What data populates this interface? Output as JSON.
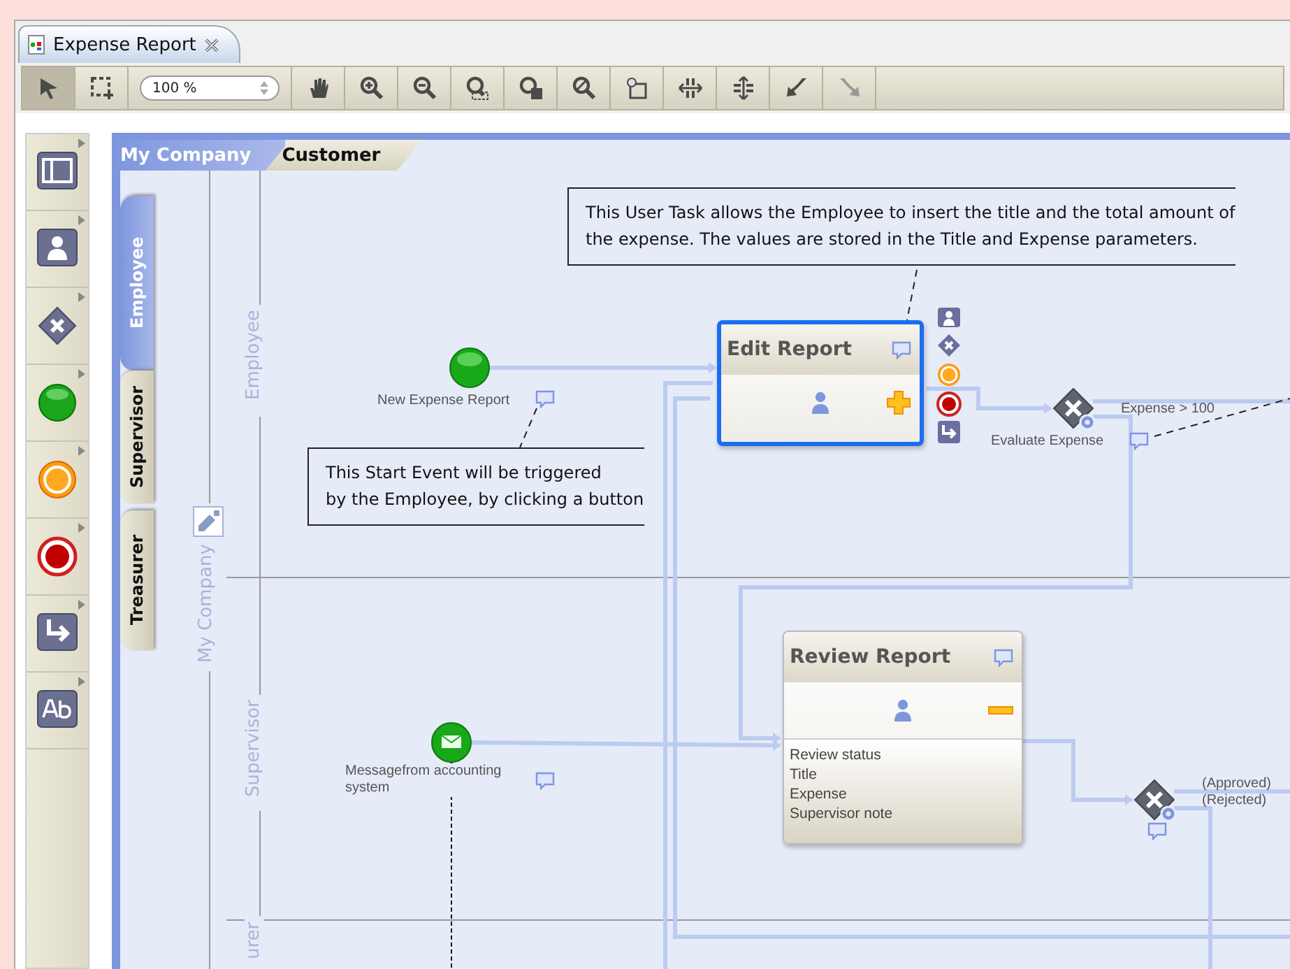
{
  "window": {
    "tab_title": "Expense Report"
  },
  "toolbar": {
    "zoom": "100 %",
    "tools_left": [
      {
        "kind": "pointer",
        "selected": true,
        "disabled": false
      },
      {
        "kind": "marquee",
        "selected": false,
        "disabled": false
      }
    ],
    "tools_right": [
      {
        "kind": "hand",
        "selected": false,
        "disabled": false
      },
      {
        "kind": "zoom_in",
        "selected": false,
        "disabled": false
      },
      {
        "kind": "zoom_out",
        "selected": false,
        "disabled": false
      },
      {
        "kind": "zoom_fit",
        "selected": false,
        "disabled": false
      },
      {
        "kind": "zoom_page",
        "selected": false,
        "disabled": false
      },
      {
        "kind": "zoom_area",
        "selected": false,
        "disabled": false
      },
      {
        "kind": "frame",
        "selected": false,
        "disabled": false
      },
      {
        "kind": "h_space",
        "selected": false,
        "disabled": false
      },
      {
        "kind": "v_space",
        "selected": false,
        "disabled": false
      },
      {
        "kind": "undo",
        "selected": false,
        "disabled": false
      },
      {
        "kind": "redo",
        "selected": false,
        "disabled": true
      }
    ]
  },
  "palette": [
    {
      "kind": "pool"
    },
    {
      "kind": "user_task"
    },
    {
      "kind": "gateway"
    },
    {
      "kind": "start_event"
    },
    {
      "kind": "intermediate_event"
    },
    {
      "kind": "end_event"
    },
    {
      "kind": "flow"
    },
    {
      "kind": "text"
    }
  ],
  "breadcrumb_tabs": [
    {
      "label": "My Company",
      "selected": true
    },
    {
      "label": "Customer",
      "selected": false
    }
  ],
  "lane_tabs": [
    {
      "label": "Employee",
      "selected": true
    },
    {
      "label": "Supervisor",
      "selected": false
    },
    {
      "label": "Treasurer",
      "selected": false
    }
  ],
  "diagram": {
    "pool_label": "My Company",
    "lanes": [
      {
        "label": "Employee"
      },
      {
        "label": "Supervisor"
      },
      {
        "label": "urer"
      }
    ],
    "annotations": [
      {
        "lines": [
          "This User Task allows the Employee to insert the title and the total amount of",
          "the expense. The values are stored in the Title and Expense parameters."
        ]
      },
      {
        "lines": [
          "This Start Event will be triggered",
          "by the Employee, by clicking a button"
        ]
      }
    ],
    "events": [
      {
        "kind": "start",
        "label": "New Expense Report"
      },
      {
        "kind": "message_start",
        "label": "Messagefrom accounting system"
      }
    ],
    "tasks": [
      {
        "title": "Edit Report",
        "selected": true,
        "expanded": false
      },
      {
        "title": "Review Report",
        "selected": false,
        "expanded": true,
        "fields": [
          "Review status",
          "Title",
          "Expense",
          "Supervisor note"
        ]
      }
    ],
    "gateways": [
      {
        "label": "Evaluate Expense",
        "flow_labels": [
          "Expense > 100"
        ]
      },
      {
        "flow_labels": [
          "(Approved)",
          "(Rejected)"
        ]
      }
    ]
  }
}
